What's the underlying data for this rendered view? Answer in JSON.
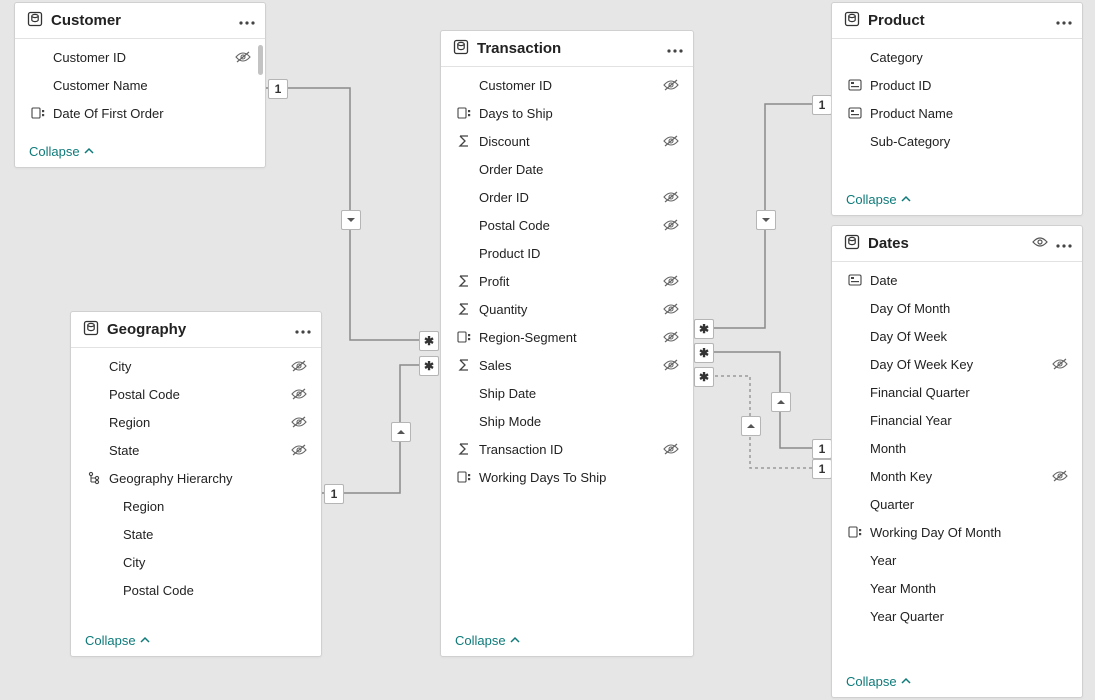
{
  "collapse_label": "Collapse",
  "cards": {
    "customer": {
      "title": "Customer",
      "fields": [
        {
          "icon": "",
          "label": "Customer ID",
          "hidden": true
        },
        {
          "icon": "",
          "label": "Customer Name",
          "hidden": false
        },
        {
          "icon": "group",
          "label": "Date Of First Order",
          "hidden": false
        }
      ]
    },
    "geography": {
      "title": "Geography",
      "fields": [
        {
          "icon": "",
          "label": "City",
          "hidden": true
        },
        {
          "icon": "",
          "label": "Postal Code",
          "hidden": true
        },
        {
          "icon": "",
          "label": "Region",
          "hidden": true
        },
        {
          "icon": "",
          "label": "State",
          "hidden": true
        },
        {
          "icon": "hierarchy",
          "label": "Geography Hierarchy",
          "hidden": false
        },
        {
          "icon": "",
          "label": "Region",
          "indent": true
        },
        {
          "icon": "",
          "label": "State",
          "indent": true
        },
        {
          "icon": "",
          "label": "City",
          "indent": true
        },
        {
          "icon": "",
          "label": "Postal Code",
          "indent": true
        }
      ]
    },
    "transaction": {
      "title": "Transaction",
      "fields": [
        {
          "icon": "",
          "label": "Customer ID",
          "hidden": true
        },
        {
          "icon": "group",
          "label": "Days to Ship",
          "hidden": false
        },
        {
          "icon": "sigma",
          "label": "Discount",
          "hidden": true
        },
        {
          "icon": "",
          "label": "Order Date",
          "hidden": false
        },
        {
          "icon": "",
          "label": "Order ID",
          "hidden": true
        },
        {
          "icon": "",
          "label": "Postal Code",
          "hidden": true
        },
        {
          "icon": "",
          "label": "Product ID",
          "hidden": false
        },
        {
          "icon": "sigma",
          "label": "Profit",
          "hidden": true
        },
        {
          "icon": "sigma",
          "label": "Quantity",
          "hidden": true
        },
        {
          "icon": "group",
          "label": "Region-Segment",
          "hidden": true
        },
        {
          "icon": "sigma",
          "label": "Sales",
          "hidden": true
        },
        {
          "icon": "",
          "label": "Ship Date",
          "hidden": false
        },
        {
          "icon": "",
          "label": "Ship Mode",
          "hidden": false
        },
        {
          "icon": "sigma",
          "label": "Transaction ID",
          "hidden": true
        },
        {
          "icon": "group",
          "label": "Working Days To Ship",
          "hidden": false
        }
      ]
    },
    "product": {
      "title": "Product",
      "fields": [
        {
          "icon": "",
          "label": "Category",
          "hidden": false
        },
        {
          "icon": "card",
          "label": "Product ID",
          "hidden": false
        },
        {
          "icon": "card",
          "label": "Product Name",
          "hidden": false
        },
        {
          "icon": "",
          "label": "Sub-Category",
          "hidden": false
        }
      ]
    },
    "dates": {
      "title": "Dates",
      "show_eye": true,
      "fields": [
        {
          "icon": "card",
          "label": "Date",
          "hidden": false
        },
        {
          "icon": "",
          "label": "Day Of Month",
          "hidden": false
        },
        {
          "icon": "",
          "label": "Day Of Week",
          "hidden": false
        },
        {
          "icon": "",
          "label": "Day Of Week Key",
          "hidden": true
        },
        {
          "icon": "",
          "label": "Financial Quarter",
          "hidden": false
        },
        {
          "icon": "",
          "label": "Financial Year",
          "hidden": false
        },
        {
          "icon": "",
          "label": "Month",
          "hidden": false
        },
        {
          "icon": "",
          "label": "Month Key",
          "hidden": true
        },
        {
          "icon": "",
          "label": "Quarter",
          "hidden": false
        },
        {
          "icon": "group",
          "label": "Working Day Of Month",
          "hidden": false
        },
        {
          "icon": "",
          "label": "Year",
          "hidden": false
        },
        {
          "icon": "",
          "label": "Year Month",
          "hidden": false
        },
        {
          "icon": "",
          "label": "Year Quarter",
          "hidden": false
        }
      ]
    }
  },
  "relationships": [
    {
      "from": "customer",
      "to": "transaction",
      "from_card": "1",
      "to_card": "*",
      "direction": "down"
    },
    {
      "from": "geography",
      "to": "transaction",
      "from_card": "1",
      "to_card": "*",
      "direction": "up"
    },
    {
      "from": "product",
      "to": "transaction",
      "from_card": "1",
      "to_card": "*",
      "direction": "down"
    },
    {
      "from": "dates",
      "to": "transaction",
      "from_card": "1",
      "to_card": "*",
      "direction": "up",
      "active": true
    },
    {
      "from": "dates",
      "to": "transaction",
      "from_card": "1",
      "to_card": "*",
      "direction": "up",
      "active": false
    }
  ]
}
